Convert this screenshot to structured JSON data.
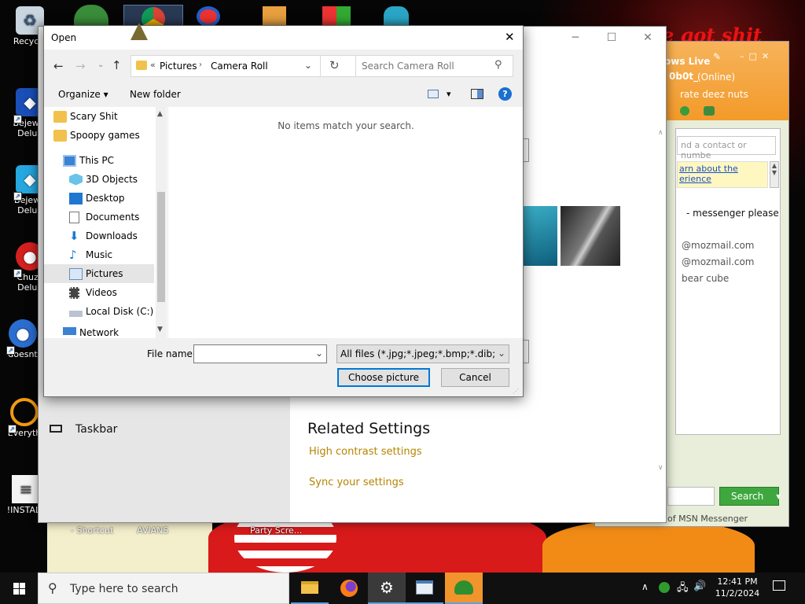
{
  "desktop": {
    "icons": [
      {
        "label": "Recycle",
        "name": "recycle-bin"
      },
      {
        "label": "Bejewel\nDelux",
        "name": "bejeweled-1"
      },
      {
        "label": "Bejewe\nDelux",
        "name": "bejeweled-2"
      },
      {
        "label": "Chuzz\nDelux",
        "name": "chuzzle"
      },
      {
        "label": "doesnt",
        "name": "doesnt"
      },
      {
        "label": "Everyth",
        "name": "everything"
      },
      {
        "label": "!INSTALL",
        "name": "install"
      }
    ],
    "bottom_labels": [
      "- Shortcut",
      "AVIANS",
      "Party Scre..."
    ],
    "wallpaper_text": "e got shit"
  },
  "settings_window": {
    "taskbar_item": "Taskbar",
    "related_heading": "Related Settings",
    "links": [
      "High contrast settings",
      "Sync your settings"
    ]
  },
  "msn": {
    "title": "ows Live",
    "user": "0b0t_",
    "status": "(Online)",
    "message": "rate deez nuts",
    "search_placeholder": "nd a contact or numbe",
    "info_link_1": "arn about the",
    "info_link_2": "erience",
    "contacts": [
      "- messenger please",
      "@mozmail.com",
      "@mozmail.com",
      "bear cube"
    ],
    "search_button": "Search",
    "footer": "of MSN Messenger"
  },
  "dialog": {
    "title": "Open",
    "breadcrumb": [
      "Pictures",
      "Camera Roll"
    ],
    "breadcrumb_overflow": "«",
    "search_placeholder": "Search Camera Roll",
    "organize_label": "Organize",
    "new_folder_label": "New folder",
    "empty_message": "No items match your search.",
    "nav_items": [
      {
        "label": "Scary Shit",
        "icon": "folder-icon"
      },
      {
        "label": "Spoopy games",
        "icon": "folder-icon"
      },
      {
        "label": "This PC",
        "icon": "computer-icon"
      },
      {
        "label": "3D Objects",
        "icon": "cube-icon"
      },
      {
        "label": "Desktop",
        "icon": "desktop-icon"
      },
      {
        "label": "Documents",
        "icon": "document-icon"
      },
      {
        "label": "Downloads",
        "icon": "download-icon"
      },
      {
        "label": "Music",
        "icon": "music-icon"
      },
      {
        "label": "Pictures",
        "icon": "pictures-icon"
      },
      {
        "label": "Videos",
        "icon": "video-icon"
      },
      {
        "label": "Local Disk (C:)",
        "icon": "disk-icon"
      },
      {
        "label": "Network",
        "icon": "network-icon"
      }
    ],
    "selected_nav": "Pictures",
    "file_name_label": "File name:",
    "file_name_value": "",
    "filter_value": "All files (*.jpg;*.jpeg;*.bmp;*.dib;*.png",
    "choose_button": "Choose picture",
    "cancel_button": "Cancel"
  },
  "taskbar": {
    "search_placeholder": "Type here to search",
    "time": "12:41 PM",
    "date": "11/2/2024"
  },
  "colors": {
    "accent_blue": "#0078d7",
    "link_gold": "#b58400",
    "msn_orange": "#f39a2a",
    "selection": "#e5e5e5"
  }
}
